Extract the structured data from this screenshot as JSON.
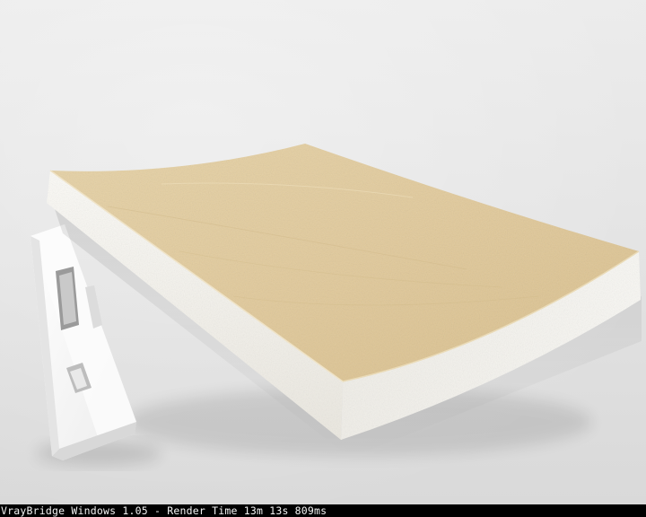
{
  "status_bar": {
    "text": "VrayBridge Windows 1.05 - Render Time 13m 13s 809ms",
    "background": "#000000",
    "color": "#f2f2f2"
  },
  "scene": {
    "background": "#e6e6e6",
    "slab_top_color": "#e2cc9c",
    "slab_side_color": "#f4f2ec",
    "device_color": "#f7f7f7"
  }
}
